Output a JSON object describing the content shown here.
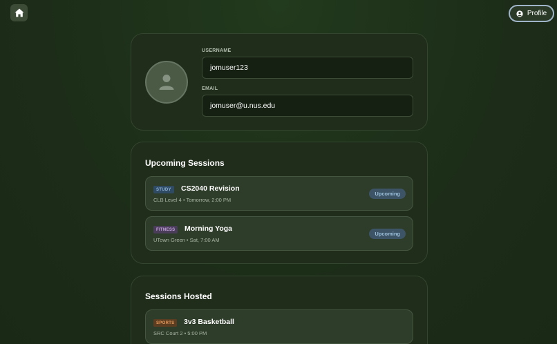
{
  "header": {
    "profile_label": "Profile"
  },
  "profile": {
    "username_label": "USERNAME",
    "username_value": "jomuser123",
    "email_label": "EMAIL",
    "email_value": "jomuser@u.nus.edu"
  },
  "upcoming": {
    "title": "Upcoming Sessions",
    "items": [
      {
        "tag": "STUDY",
        "title": "CS2040 Revision",
        "subtitle": "CLB Level 4 • Tomorrow, 2:00 PM",
        "status": "Upcoming"
      },
      {
        "tag": "FITNESS",
        "title": "Morning Yoga",
        "subtitle": "UTown Green • Sat, 7:00 AM",
        "status": "Upcoming"
      }
    ]
  },
  "hosted": {
    "title": "Sessions Hosted",
    "items": [
      {
        "tag": "SPORTS",
        "title": "3v3 Basketball",
        "subtitle": "SRC Court 2 • 5:00 PM"
      }
    ]
  },
  "colors": {
    "background": "#1e2f19",
    "card": "#1f2d1a",
    "study_tag": "#2f4b63",
    "fitness_tag": "#4a3d5a",
    "sports_tag": "#5b3d22",
    "status_badge": "#3d5466"
  },
  "icons": {
    "home": "home-icon",
    "profile": "user-circle-icon",
    "avatar": "user-icon"
  }
}
